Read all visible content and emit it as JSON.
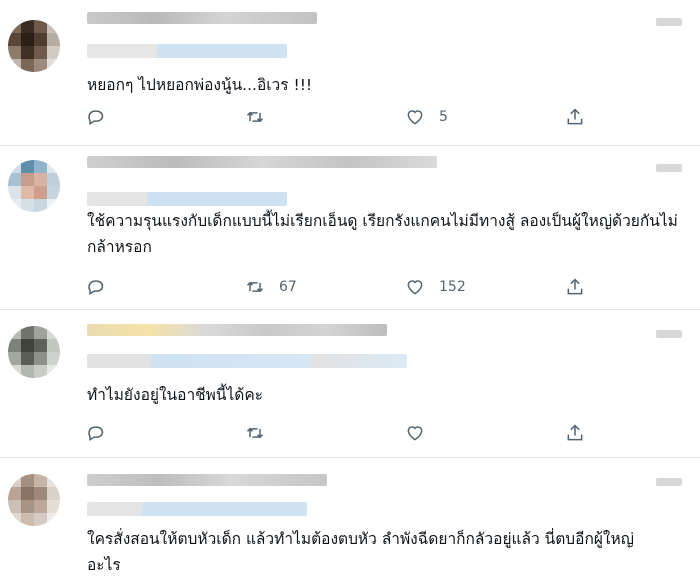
{
  "tweets": [
    {
      "text": "หยอกๆ ไปหยอกพ่องนู้น...อิเวร !!!",
      "reply_count": "",
      "retweet_count": "",
      "like_count": "5",
      "avatar_colors": [
        "#7b6a5c",
        "#3a2c22",
        "#6d5a4b",
        "#c8bfb6",
        "#5a4638",
        "#2b1f18",
        "#4e3d31",
        "#b7aca2",
        "#8d7b6c",
        "#3f2f24",
        "#6e5b4d",
        "#d2cbc4",
        "#c2b7ad",
        "#7a6757",
        "#9c8b7d",
        "#e3ddd8"
      ]
    },
    {
      "text": "ใช้ความรุนแรงกับเด็กแบบนี้ไม่เรียกเอ็นดู เรียกรังแกคนไม่มีทางสู้ ลองเป็นผู้ใหญ่ด้วยกันไม่กล้าหรอก",
      "reply_count": "",
      "retweet_count": "67",
      "like_count": "152",
      "avatar_colors": [
        "#cfdce6",
        "#5f8eaa",
        "#8fb4cb",
        "#dfe8ee",
        "#a8c0d2",
        "#c79d8c",
        "#d8b3a3",
        "#bfcfdc",
        "#dbe4eb",
        "#e0b9a7",
        "#cf9f8d",
        "#c6d4df",
        "#e6edf2",
        "#d7dfe6",
        "#cad6e0",
        "#eef2f5"
      ]
    },
    {
      "text": "ทำไมยังอยู่ในอาชีพนี้ได้คะ",
      "reply_count": "",
      "retweet_count": "",
      "like_count": "",
      "avatar_colors": [
        "#b9bdb6",
        "#6f746c",
        "#9ea399",
        "#d5d8d2",
        "#7c8179",
        "#3e423c",
        "#5c6159",
        "#c3c7c0",
        "#a3a79f",
        "#595e56",
        "#8c9189",
        "#cfd2cc",
        "#d8dbd5",
        "#b2b6ae",
        "#c9ccc5",
        "#e6e8e4"
      ]
    },
    {
      "text": "ใครสั่งสอนให้ตบหัวเด็ก แล้วทำไมต้องตบหัว ลำพังฉีดยาก็กลัวอยู่แล้ว นี่ตบอีกผู้ใหญ่อะไร",
      "reply_count": "",
      "retweet_count": "",
      "like_count": "",
      "avatar_colors": [
        "#d9cfc7",
        "#a48f80",
        "#c6b4a6",
        "#e7e0da",
        "#b8a395",
        "#8a7364",
        "#9f897a",
        "#dbd1c9",
        "#cdbfb3",
        "#a99383",
        "#bca89a",
        "#e5ddd6",
        "#e0d8d1",
        "#cbbcaf",
        "#d6cbc2",
        "#efeae6"
      ]
    }
  ]
}
